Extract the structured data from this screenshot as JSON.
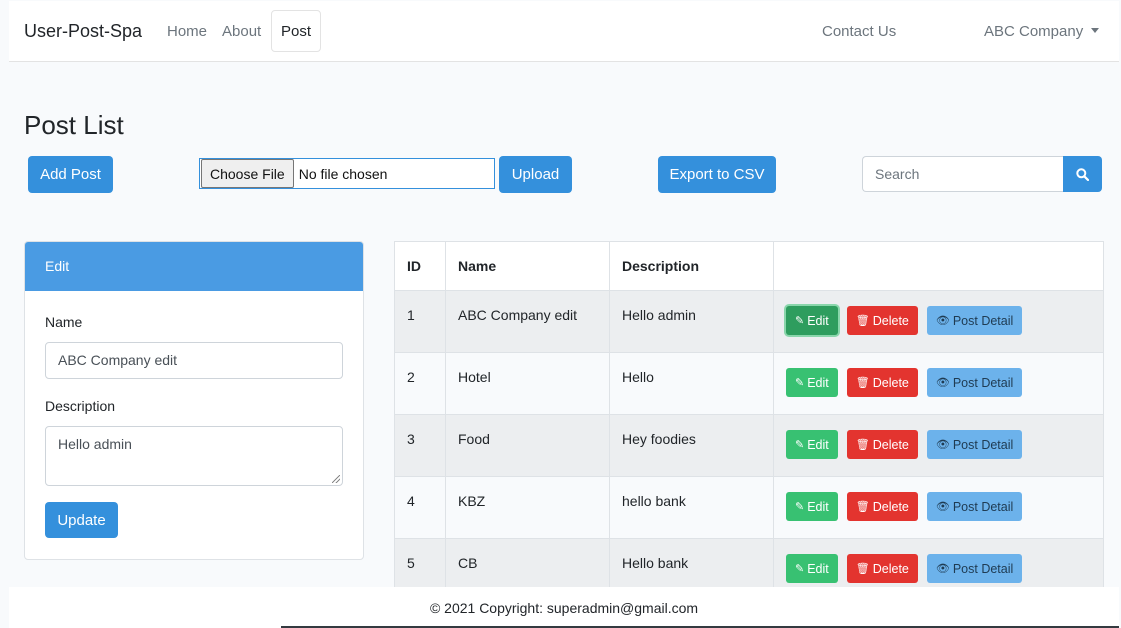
{
  "nav": {
    "brand": "User-Post-Spa",
    "links": [
      "Home",
      "About",
      "Post"
    ],
    "contact": "Contact Us",
    "company": "ABC Company"
  },
  "page": {
    "title": "Post List"
  },
  "toolbar": {
    "add_post": "Add Post",
    "choose_file": "Choose File",
    "no_file": "No file chosen",
    "upload": "Upload",
    "export": "Export to CSV",
    "search_placeholder": "Search"
  },
  "edit_form": {
    "header": "Edit",
    "name_label": "Name",
    "name_value": "ABC Company edit",
    "description_label": "Description",
    "description_value": "Hello admin",
    "update": "Update"
  },
  "table": {
    "headers": [
      "ID",
      "Name",
      "Description",
      ""
    ],
    "rows": [
      {
        "id": "1",
        "name": "ABC Company edit",
        "description": "Hello admin"
      },
      {
        "id": "2",
        "name": "Hotel",
        "description": "Hello"
      },
      {
        "id": "3",
        "name": "Food",
        "description": "Hey foodies"
      },
      {
        "id": "4",
        "name": "KBZ",
        "description": "hello bank"
      },
      {
        "id": "5",
        "name": "CB",
        "description": "Hello bank"
      }
    ],
    "actions": {
      "edit": "Edit",
      "delete": "Delete",
      "detail": "Post Detail"
    }
  },
  "footer": {
    "text": "© 2021 Copyright: superadmin@gmail.com"
  },
  "colors": {
    "primary": "#3490dc",
    "success": "#38c172",
    "danger": "#e3342f",
    "info": "#6cb2eb"
  }
}
